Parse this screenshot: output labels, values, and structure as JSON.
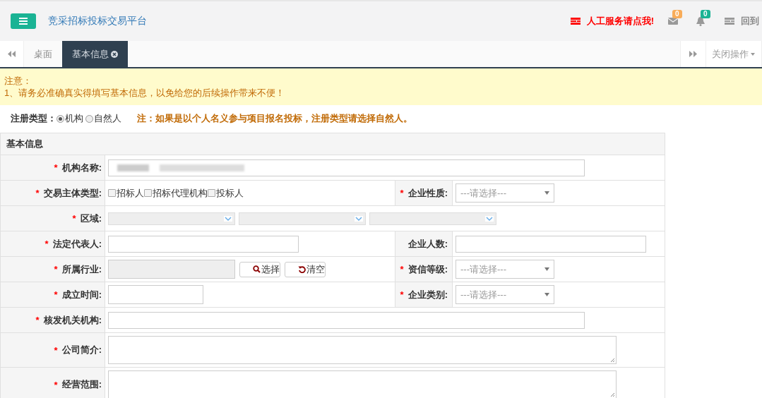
{
  "header": {
    "title": "竞采招标投标交易平台",
    "service_link": "人工服务请点我!",
    "mail_badge": "0",
    "bell_badge": "0",
    "home_link": "回到"
  },
  "tabs": [
    {
      "label": "桌面",
      "selected": false,
      "closable": false
    },
    {
      "label": "基本信息",
      "selected": true,
      "closable": true
    }
  ],
  "close_menu": "关闭操作",
  "notice": {
    "title": "注意：",
    "lines": [
      "1、请务必准确真实得填写基本信息，以免给您的后续操作带来不便！"
    ]
  },
  "reg_type": {
    "label": "注册类型：",
    "options": [
      {
        "label": "机构",
        "selected": true
      },
      {
        "label": "自然人",
        "selected": false
      }
    ],
    "note": "注：如果是以个人名义参与项目报名投标，注册类型请选择自然人。"
  },
  "form": {
    "title": "基本信息",
    "rows": [
      [
        {
          "label": "机构名称:",
          "required_mark": "*",
          "kind": "text",
          "redacted": true
        }
      ],
      [
        {
          "label": "交易主体类型:",
          "required_mark": "*",
          "kind": "checkboxes",
          "options": [
            {
              "label": "招标人",
              "checked": false
            },
            {
              "label": "招标代理机构",
              "checked": false
            },
            {
              "label": "投标人",
              "checked": false
            }
          ]
        },
        {
          "label": "企业性质:",
          "required_mark": "*",
          "kind": "select",
          "placeholder": "---请选择---"
        }
      ],
      [
        {
          "label": "区域:",
          "required_mark": "*",
          "kind": "region",
          "dropdowns": [
            {
              "disabled": true
            },
            {
              "disabled": true
            },
            {
              "disabled": true
            }
          ]
        }
      ],
      [
        {
          "label": "法定代表人:",
          "required_mark": "*",
          "kind": "text"
        },
        {
          "label": "企业人数:",
          "kind": "text"
        }
      ],
      [
        {
          "label": "所属行业:",
          "required_mark": "*",
          "kind": "picker",
          "buttons": [
            {
              "label": "选择",
              "kind": "search"
            },
            {
              "label": "清空",
              "kind": "reset"
            }
          ]
        },
        {
          "label": "资信等级:",
          "required_mark": "*",
          "kind": "select",
          "placeholder": "---请选择---"
        }
      ],
      [
        {
          "label": "成立时间:",
          "required_mark": "*",
          "kind": "date"
        },
        {
          "label": "企业类别:",
          "required_mark": "*",
          "kind": "select",
          "placeholder": "---请选择---"
        }
      ],
      [
        {
          "label": "核发机关机构:",
          "required_mark": "*",
          "kind": "text"
        }
      ],
      [
        {
          "label": "公司简介:",
          "required_mark": "*",
          "kind": "textarea"
        }
      ],
      [
        {
          "label": "经营范围:",
          "required_mark": "*",
          "kind": "textarea"
        }
      ]
    ]
  }
}
